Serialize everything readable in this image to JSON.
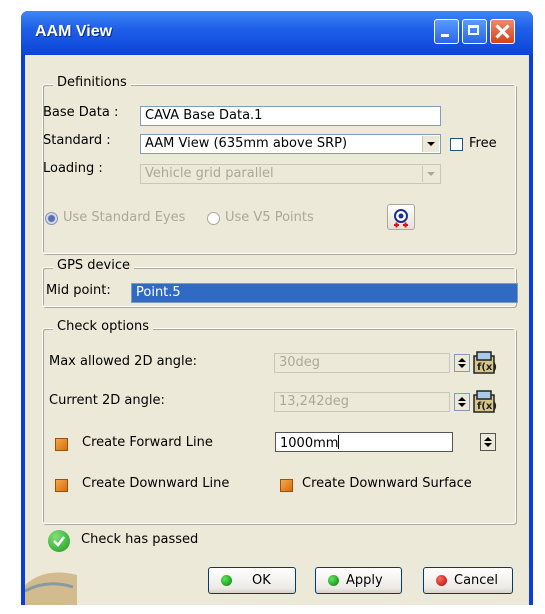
{
  "window": {
    "title": "AAM View"
  },
  "definitions": {
    "legend": "Definitions",
    "base_data_label": "Base Data :",
    "base_data_value": "CAVA Base Data.1",
    "standard_label": "Standard :",
    "standard_value": "AAM View (635mm above SRP)",
    "free_label": "Free",
    "loading_label": "Loading :",
    "loading_value": "Vehicle grid parallel",
    "use_standard_eyes": "Use Standard Eyes",
    "use_v5_points": "Use V5 Points"
  },
  "gps": {
    "legend": "GPS device",
    "mid_point_label": "Mid point:",
    "mid_point_value": "Point.5"
  },
  "check_options": {
    "legend": "Check options",
    "max_angle_label": "Max allowed 2D angle:",
    "max_angle_value": "30deg",
    "current_angle_label": "Current 2D angle:",
    "current_angle_value": "13,242deg",
    "forward_line_label": "Create Forward Line",
    "forward_line_value": "1000mm",
    "downward_line_label": "Create Downward Line",
    "downward_surface_label": "Create Downward Surface"
  },
  "status": {
    "message": "Check has passed"
  },
  "buttons": {
    "ok": "OK",
    "apply": "Apply",
    "cancel": "Cancel"
  },
  "colors": {
    "title_blue": "#0a45d8",
    "selection": "#316ac5",
    "ok_green": "#1f9b1a"
  },
  "icons": [
    "minimize-icon",
    "maximize-icon",
    "close-icon",
    "dropdown-arrow-icon",
    "point-pick-icon",
    "spinner-icon",
    "formula-icon",
    "check-passed-icon",
    "ok-dot-icon",
    "apply-dot-icon",
    "cancel-dot-icon"
  ]
}
